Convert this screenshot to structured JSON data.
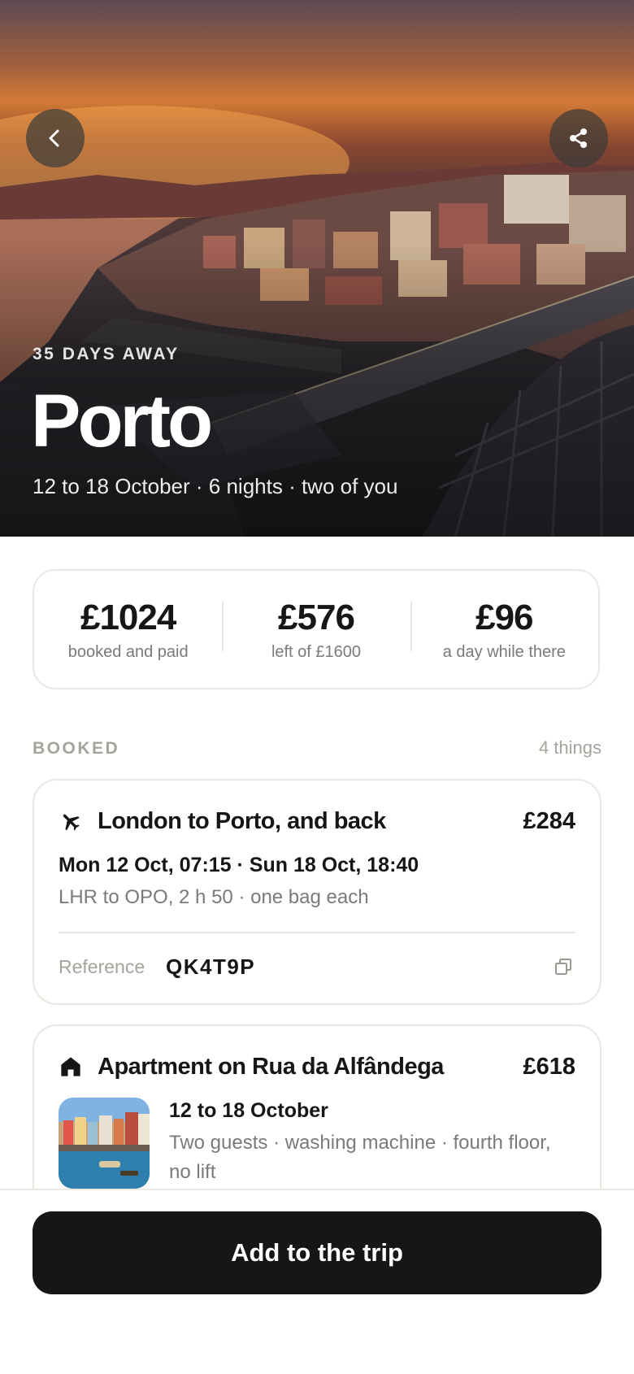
{
  "hero": {
    "countdown": "35 DAYS AWAY",
    "city": "Porto",
    "meta": "12 to 18 October · 6 nights · two of you"
  },
  "stats": [
    {
      "value": "£1024",
      "label": "booked and paid"
    },
    {
      "value": "£576",
      "label": "left of £1600"
    },
    {
      "value": "£96",
      "label": "a day while there"
    }
  ],
  "section": {
    "title": "BOOKED",
    "count": "4 things"
  },
  "flight": {
    "icon": "airplane-icon",
    "title": "London to Porto, and back",
    "price": "£284",
    "times": "Mon 12 Oct, 07:15 · Sun 18 Oct, 18:40",
    "route": "LHR to OPO, 2 h 50 · one bag each",
    "reference_label": "Reference",
    "reference_code": "QK4T9P"
  },
  "apartment": {
    "icon": "home-icon",
    "title": "Apartment on Rua da Alfândega",
    "price": "£618",
    "dates": "12 to 18 October",
    "details": "Two guests · washing machine · fourth floor, no lift"
  },
  "cta": {
    "label": "Add to the trip"
  },
  "colors": {
    "button": "#161616",
    "border": "#ebe8e2",
    "muted": "#7a7a76"
  }
}
